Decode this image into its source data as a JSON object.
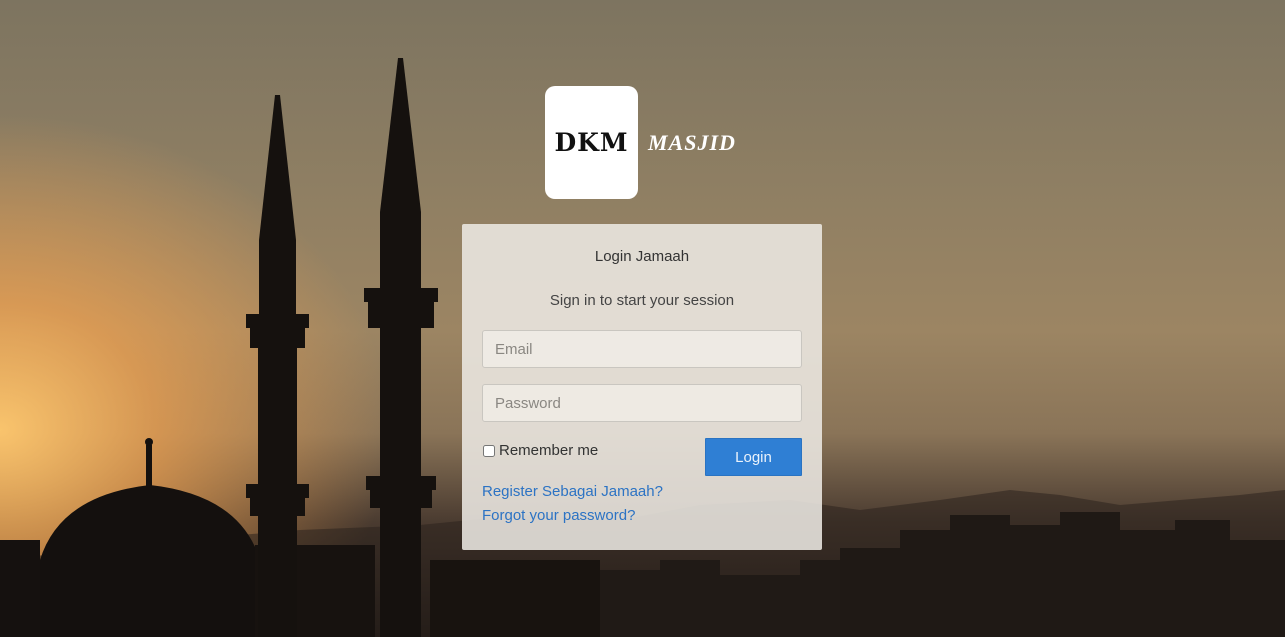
{
  "brand": {
    "logo_text": "DKM",
    "name": "MASJID"
  },
  "login": {
    "title": "Login Jamaah",
    "message": "Sign in to start your session",
    "email_placeholder": "Email",
    "password_placeholder": "Password",
    "remember_label": "Remember me",
    "submit_label": "Login",
    "register_link": "Register Sebagai Jamaah?",
    "forgot_link": "Forgot your password?"
  },
  "colors": {
    "primary_button": "#2f7fd4",
    "link": "#2c73c4"
  }
}
